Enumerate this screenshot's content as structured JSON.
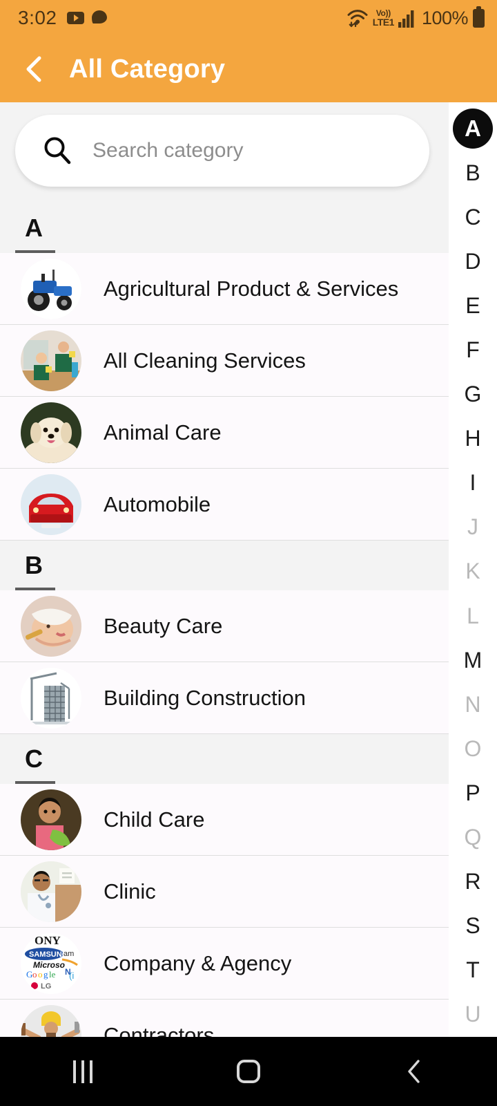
{
  "status_bar": {
    "time": "3:02",
    "battery_percent": "100%",
    "network_label_top": "Vo))",
    "network_label_bottom": "LTE1",
    "icons": [
      "youtube-icon",
      "chat-bubble-icon",
      "wifi-icon",
      "volte-icon",
      "signal-bars-icon",
      "battery-icon"
    ]
  },
  "app_bar": {
    "title": "All Category",
    "back_icon": "chevron-left-icon",
    "background_color": "#F4A63F",
    "title_color": "#FFFFFF"
  },
  "search": {
    "placeholder": "Search category",
    "value": "",
    "icon": "search-icon"
  },
  "sections": [
    {
      "letter": "A",
      "items": [
        {
          "label": "Agricultural Product & Services",
          "thumb": "tractor-image"
        },
        {
          "label": "All Cleaning Services",
          "thumb": "cleaners-image"
        },
        {
          "label": "Animal Care",
          "thumb": "puppy-image"
        },
        {
          "label": "Automobile",
          "thumb": "red-car-image"
        }
      ]
    },
    {
      "letter": "B",
      "items": [
        {
          "label": "Beauty Care",
          "thumb": "facial-treatment-image"
        },
        {
          "label": "Building Construction",
          "thumb": "construction-crane-image"
        }
      ]
    },
    {
      "letter": "C",
      "items": [
        {
          "label": "Child Care",
          "thumb": "child-image"
        },
        {
          "label": "Clinic",
          "thumb": "doctor-image"
        },
        {
          "label": "Company & Agency",
          "thumb": "brand-logos-image"
        },
        {
          "label": "Contractors",
          "thumb": "handyman-image"
        }
      ]
    }
  ],
  "index_strip": {
    "selected": "A",
    "letters": [
      {
        "letter": "A",
        "enabled": true
      },
      {
        "letter": "B",
        "enabled": true
      },
      {
        "letter": "C",
        "enabled": true
      },
      {
        "letter": "D",
        "enabled": true
      },
      {
        "letter": "E",
        "enabled": true
      },
      {
        "letter": "F",
        "enabled": true
      },
      {
        "letter": "G",
        "enabled": true
      },
      {
        "letter": "H",
        "enabled": true
      },
      {
        "letter": "I",
        "enabled": true
      },
      {
        "letter": "J",
        "enabled": false
      },
      {
        "letter": "K",
        "enabled": false
      },
      {
        "letter": "L",
        "enabled": false
      },
      {
        "letter": "M",
        "enabled": true
      },
      {
        "letter": "N",
        "enabled": false
      },
      {
        "letter": "O",
        "enabled": false
      },
      {
        "letter": "P",
        "enabled": true
      },
      {
        "letter": "Q",
        "enabled": false
      },
      {
        "letter": "R",
        "enabled": true
      },
      {
        "letter": "S",
        "enabled": true
      },
      {
        "letter": "T",
        "enabled": true
      },
      {
        "letter": "U",
        "enabled": false
      }
    ]
  },
  "nav_bar": {
    "recents_label": "recents-icon",
    "home_label": "home-icon",
    "back_label": "back-icon"
  },
  "theme": {
    "accent": "#F4A63F",
    "section_bg": "#F3F3F3",
    "row_bg": "#FDFAFD",
    "divider": "#DEDEDE",
    "text": "#141414",
    "dim_text": "#B9B9B9"
  }
}
